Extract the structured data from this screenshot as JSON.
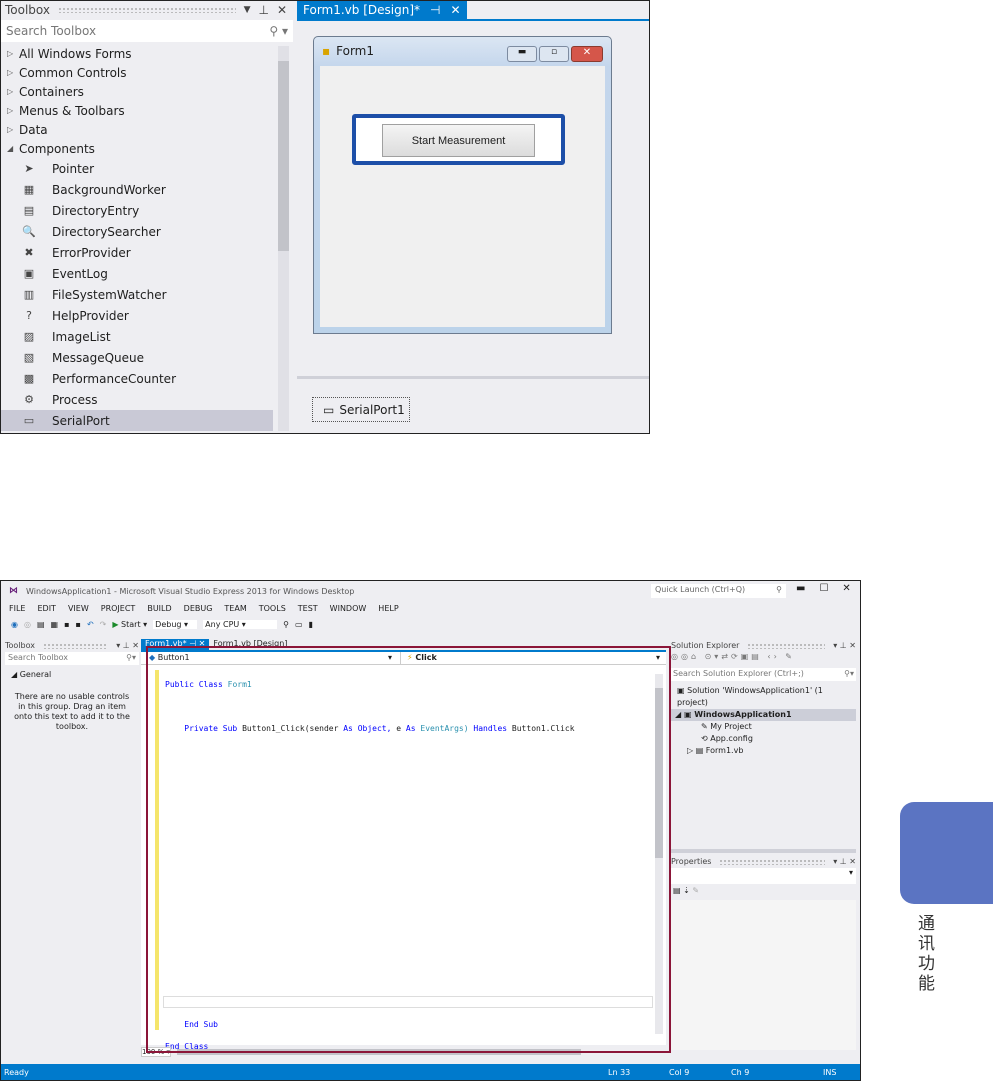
{
  "top": {
    "toolbox": {
      "title": "Toolbox",
      "search_placeholder": "Search Toolbox",
      "groups": [
        {
          "label": "All Windows Forms",
          "expanded": false
        },
        {
          "label": "Common Controls",
          "expanded": false
        },
        {
          "label": "Containers",
          "expanded": false
        },
        {
          "label": "Menus & Toolbars",
          "expanded": false
        },
        {
          "label": "Data",
          "expanded": false
        },
        {
          "label": "Components",
          "expanded": true
        }
      ],
      "components": [
        {
          "label": "Pointer",
          "icon": "➤"
        },
        {
          "label": "BackgroundWorker",
          "icon": "▦"
        },
        {
          "label": "DirectoryEntry",
          "icon": "▤"
        },
        {
          "label": "DirectorySearcher",
          "icon": "🔍"
        },
        {
          "label": "ErrorProvider",
          "icon": "✖"
        },
        {
          "label": "EventLog",
          "icon": "▣"
        },
        {
          "label": "FileSystemWatcher",
          "icon": "▥"
        },
        {
          "label": "HelpProvider",
          "icon": "?"
        },
        {
          "label": "ImageList",
          "icon": "▨"
        },
        {
          "label": "MessageQueue",
          "icon": "▧"
        },
        {
          "label": "PerformanceCounter",
          "icon": "▩"
        },
        {
          "label": "Process",
          "icon": "⚙"
        },
        {
          "label": "SerialPort",
          "icon": "▭",
          "selected": true
        }
      ]
    },
    "tab": "Form1.vb [Design]*",
    "form": {
      "title": "Form1",
      "button": "Start Measurement"
    },
    "tray": {
      "component": "SerialPort1"
    }
  },
  "bottom": {
    "title": "WindowsApplication1 - Microsoft Visual Studio Express 2013 for Windows Desktop",
    "quick_launch": "Quick Launch (Ctrl+Q)",
    "menu": [
      "FILE",
      "EDIT",
      "VIEW",
      "PROJECT",
      "BUILD",
      "DEBUG",
      "TEAM",
      "TOOLS",
      "TEST",
      "WINDOW",
      "HELP"
    ],
    "toolbar": {
      "start": "Start",
      "config": "Debug",
      "platform": "Any CPU"
    },
    "toolbox": {
      "title": "Toolbox",
      "search_placeholder": "Search Toolbox",
      "group": "General",
      "empty": "There are no usable controls in this group. Drag an item onto this text to add it to the toolbox."
    },
    "tabs": [
      "Form1.vb*",
      "Form1.vb [Design]"
    ],
    "editor": {
      "object": "Button1",
      "event": "Click",
      "zoom": "100 %",
      "lines": {
        "l1a": "Public Class",
        "l1b": "Form1",
        "l2a": "Private Sub",
        "l2b": "Button1_Click(sender",
        "l2c": "As",
        "l2d": "Object,",
        "l2e": "e",
        "l2f": "As",
        "l2g": "EventArgs)",
        "l2h": "Handles",
        "l2i": "Button1.Click",
        "l3": "End Sub",
        "l4": "End Class"
      }
    },
    "solution": {
      "title": "Solution Explorer",
      "search_placeholder": "Search Solution Explorer (Ctrl+;)",
      "items": [
        "Solution 'WindowsApplication1' (1 project)",
        "WindowsApplication1",
        "My Project",
        "App.config",
        "Form1.vb"
      ]
    },
    "properties": {
      "title": "Properties"
    },
    "status": {
      "text": "Ready",
      "ln": "Ln 33",
      "col": "Col 9",
      "ch": "Ch 9",
      "mode": "INS"
    }
  },
  "side_tab": {
    "label": "通讯功能",
    "color": "#5b74c2"
  }
}
